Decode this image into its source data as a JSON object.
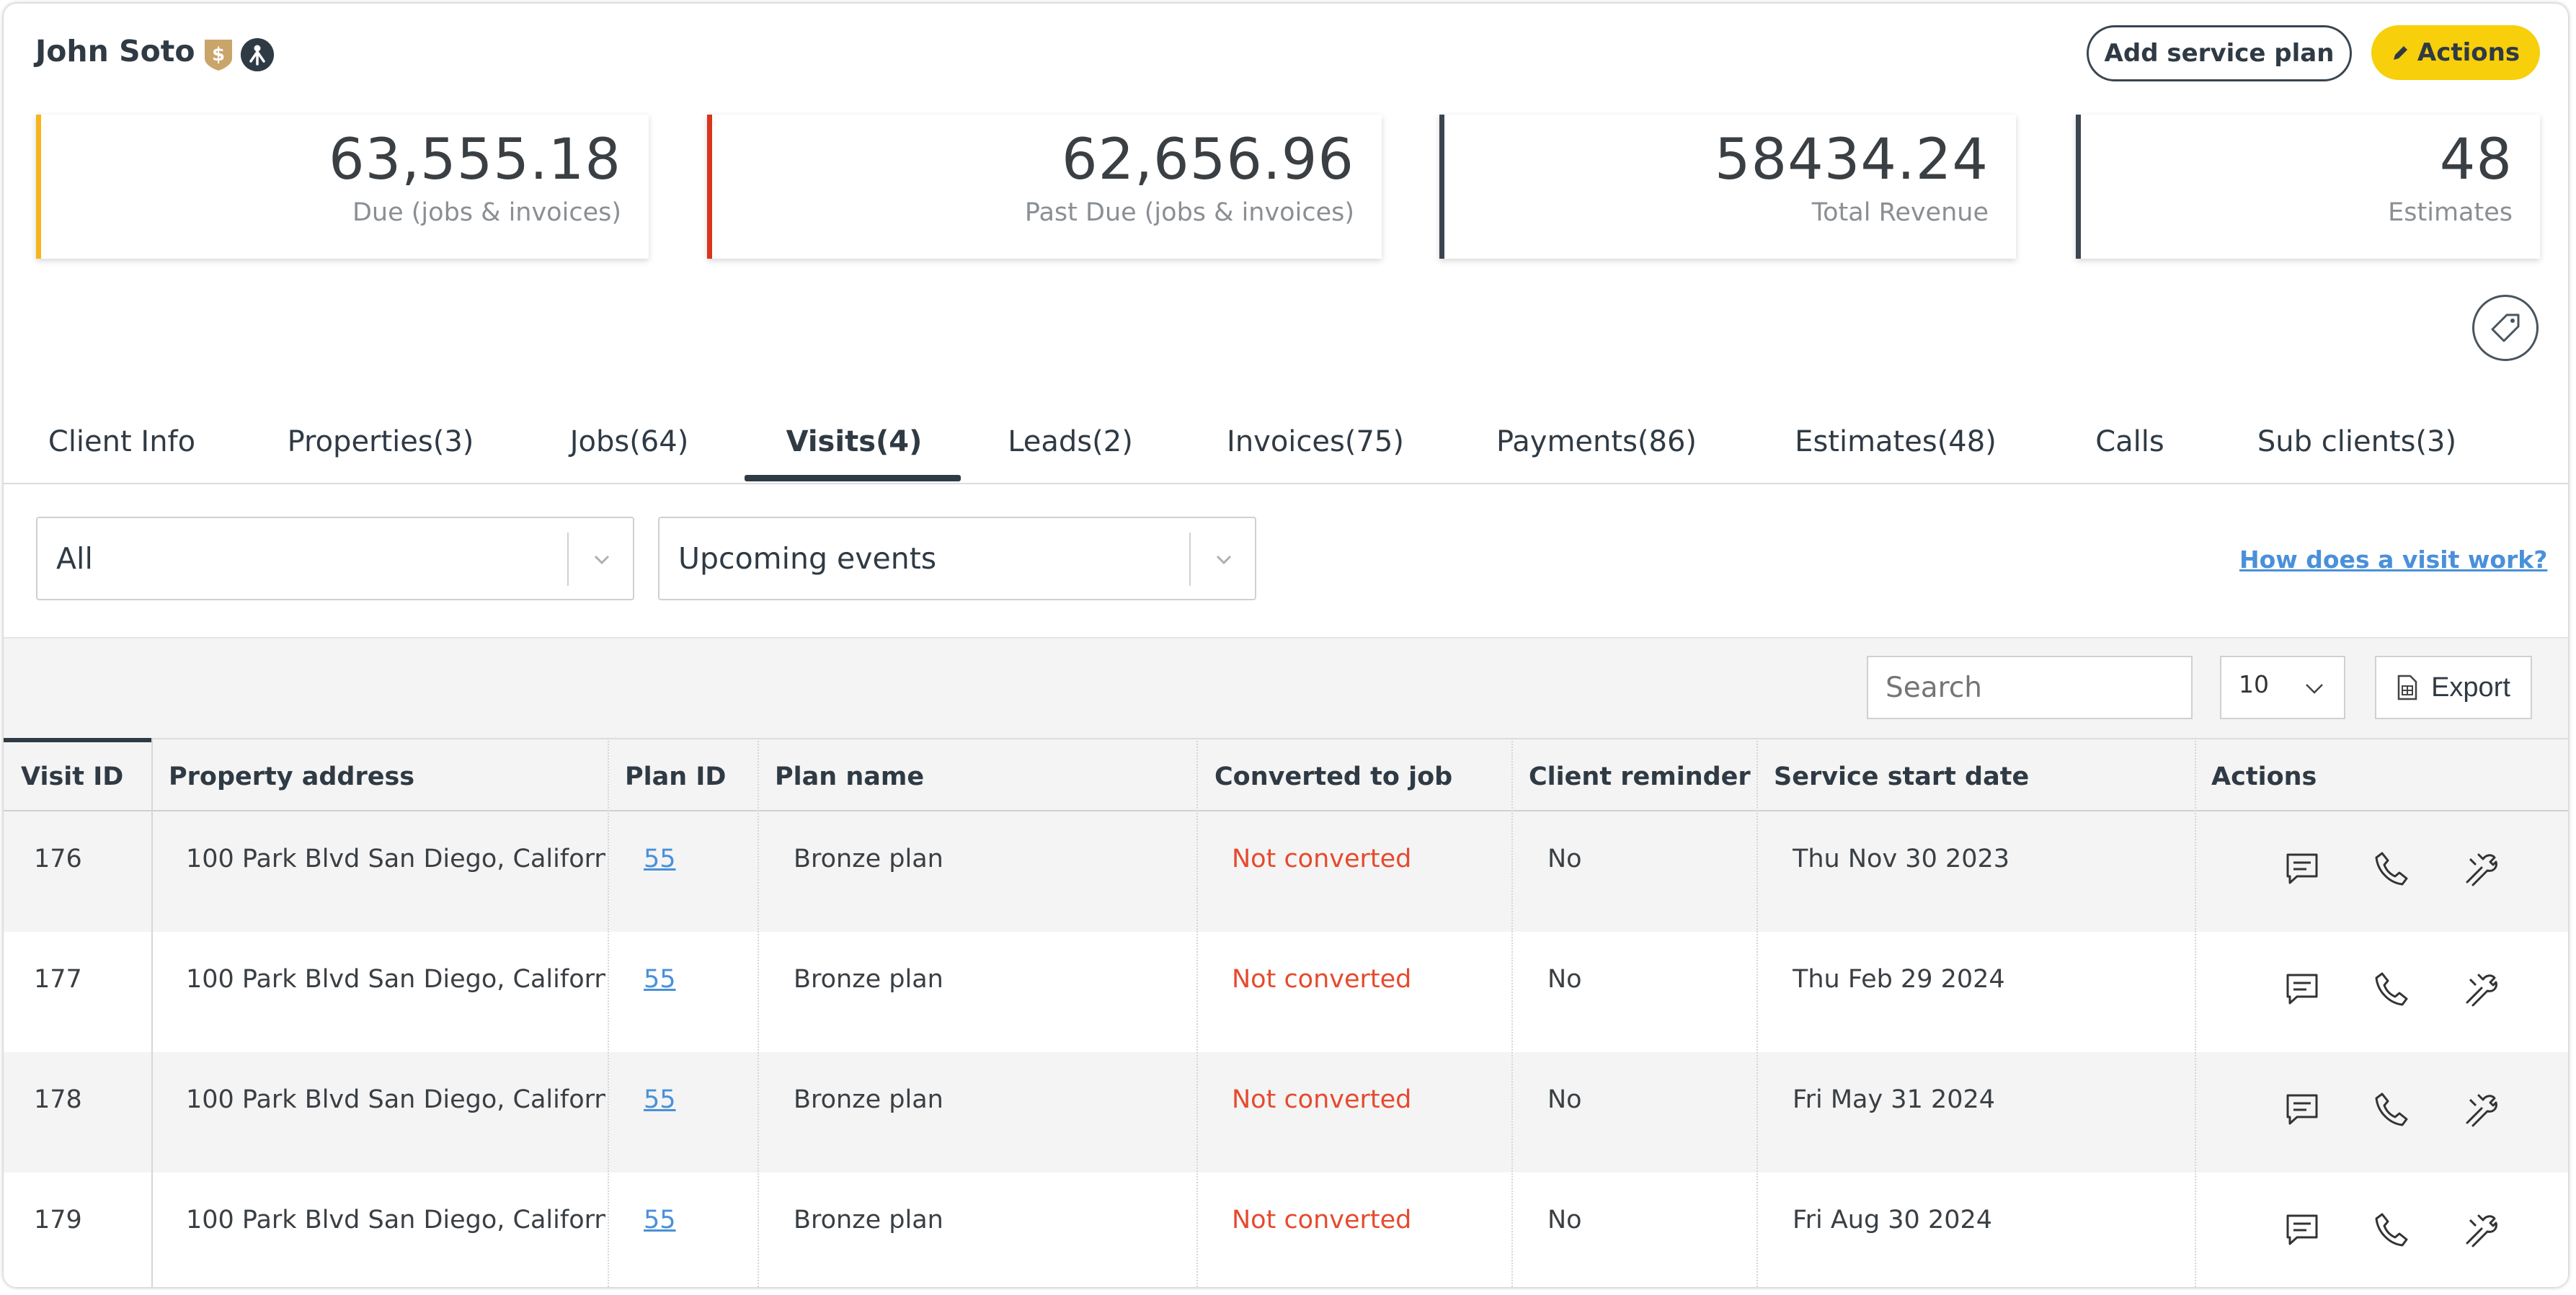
{
  "header": {
    "client_name": "John Soto",
    "add_service_plan_label": "Add service plan",
    "actions_label": "Actions"
  },
  "stats": [
    {
      "value": "63,555.18",
      "label": "Due (jobs & invoices)",
      "color": "#f7b51c"
    },
    {
      "value": "62,656.96",
      "label": "Past Due (jobs & invoices)",
      "color": "#d8341e"
    },
    {
      "value": "58434.24",
      "label": "Total Revenue",
      "color": "#3a4550"
    },
    {
      "value": "48",
      "label": "Estimates",
      "color": "#3a4550"
    }
  ],
  "tabs": [
    {
      "label": "Client Info"
    },
    {
      "label": "Properties(3)"
    },
    {
      "label": "Jobs(64)"
    },
    {
      "label": "Visits(4)",
      "active": true
    },
    {
      "label": "Leads(2)"
    },
    {
      "label": "Invoices(75)"
    },
    {
      "label": "Payments(86)"
    },
    {
      "label": "Estimates(48)"
    },
    {
      "label": "Calls"
    },
    {
      "label": "Sub clients(3)"
    }
  ],
  "filters": {
    "type_value": "All",
    "events_value": "Upcoming events",
    "help_link": "How does a visit work?"
  },
  "toolbar": {
    "search_placeholder": "Search",
    "page_size": "10",
    "export_label": "Export"
  },
  "table": {
    "columns": [
      "Visit ID",
      "Property address",
      "Plan ID",
      "Plan name",
      "Converted to job",
      "Client reminder",
      "Service start date",
      "Actions"
    ],
    "rows": [
      {
        "visit_id": "176",
        "address": "100 Park Blvd San Diego, Californ",
        "plan_id": "55",
        "plan_name": "Bronze plan",
        "converted": "Not converted",
        "reminder": "No",
        "start_date": "Thu Nov 30 2023"
      },
      {
        "visit_id": "177",
        "address": "100 Park Blvd San Diego, Californ",
        "plan_id": "55",
        "plan_name": "Bronze plan",
        "converted": "Not converted",
        "reminder": "No",
        "start_date": "Thu Feb 29 2024"
      },
      {
        "visit_id": "178",
        "address": "100 Park Blvd San Diego, Californ",
        "plan_id": "55",
        "plan_name": "Bronze plan",
        "converted": "Not converted",
        "reminder": "No",
        "start_date": "Fri May 31 2024"
      },
      {
        "visit_id": "179",
        "address": "100 Park Blvd San Diego, Californ",
        "plan_id": "55",
        "plan_name": "Bronze plan",
        "converted": "Not converted",
        "reminder": "No",
        "start_date": "Fri Aug 30 2024"
      }
    ]
  },
  "icons": {
    "shield": "shield-dollar-icon",
    "person": "person-up-icon",
    "pencil": "pencil-icon",
    "tag": "tag-icon",
    "chevron": "chevron-down-icon",
    "file": "spreadsheet-file-icon",
    "message": "message-icon",
    "phone": "phone-icon",
    "wrench": "wrench-icon"
  },
  "colors": {
    "accent_yellow": "#f7cf0b",
    "link_blue": "#4a90d9",
    "status_red": "#e64a2e",
    "dark": "#2e3b45"
  }
}
